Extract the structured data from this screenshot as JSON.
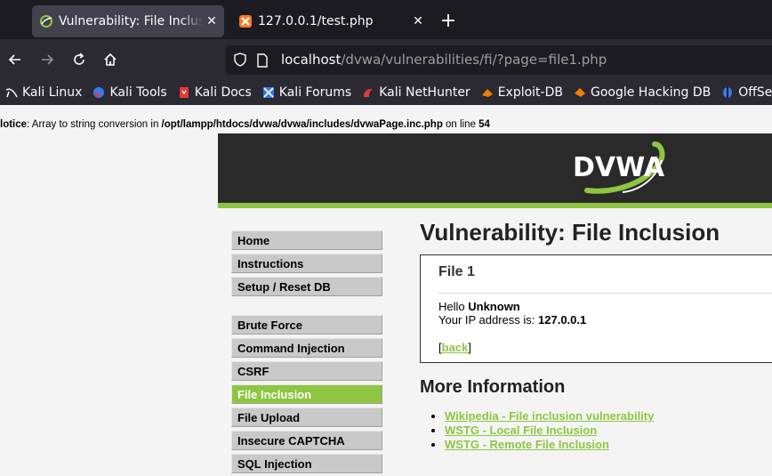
{
  "tabs": [
    {
      "label": "Vulnerability: File Inclusion",
      "active": true
    },
    {
      "label": "127.0.0.1/test.php",
      "active": false
    }
  ],
  "urlbar": {
    "host": "localhost",
    "path": "/dvwa/vulnerabilities/fi/?page=file1.php"
  },
  "bookmarks": [
    {
      "label": "Kali Linux",
      "icon": "kali-dragon-icon"
    },
    {
      "label": "Kali Tools",
      "icon": "kali-tools-icon"
    },
    {
      "label": "Kali Docs",
      "icon": "kali-docs-icon"
    },
    {
      "label": "Kali Forums",
      "icon": "kali-forums-icon"
    },
    {
      "label": "Kali NetHunter",
      "icon": "nethunter-icon"
    },
    {
      "label": "Exploit-DB",
      "icon": "exploit-db-icon"
    },
    {
      "label": "Google Hacking DB",
      "icon": "ghdb-icon"
    },
    {
      "label": "OffSec",
      "icon": "offsec-icon"
    }
  ],
  "notice": {
    "label": "lotice",
    "text": ": Array to string conversion in ",
    "path": "/opt/lampp/htdocs/dvwa/dvwa/includes/dvwaPage.inc.php",
    "online": " on line ",
    "line": "54"
  },
  "logo": {
    "text": "DVWA"
  },
  "menu": {
    "group1": [
      "Home",
      "Instructions",
      "Setup / Reset DB"
    ],
    "group2": [
      "Brute Force",
      "Command Injection",
      "CSRF",
      "File Inclusion",
      "File Upload",
      "Insecure CAPTCHA",
      "SQL Injection"
    ],
    "selected": "File Inclusion"
  },
  "main": {
    "title": "Vulnerability: File Inclusion",
    "box": {
      "title": "File 1",
      "hello_prefix": "Hello ",
      "hello_name": "Unknown",
      "ip_prefix": "Your IP address is: ",
      "ip": "127.0.0.1",
      "back_open": "[",
      "back_label": "back",
      "back_close": "]"
    },
    "more_title": "More Information",
    "links": [
      "Wikipedia - File inclusion vulnerability",
      "WSTG - Local File Inclusion",
      "WSTG - Remote File Inclusion"
    ]
  },
  "colors": {
    "accent": "#8ec641",
    "header": "#2a2a2a",
    "tabbar": "#1c1b22",
    "toolbar": "#2b2a33"
  }
}
